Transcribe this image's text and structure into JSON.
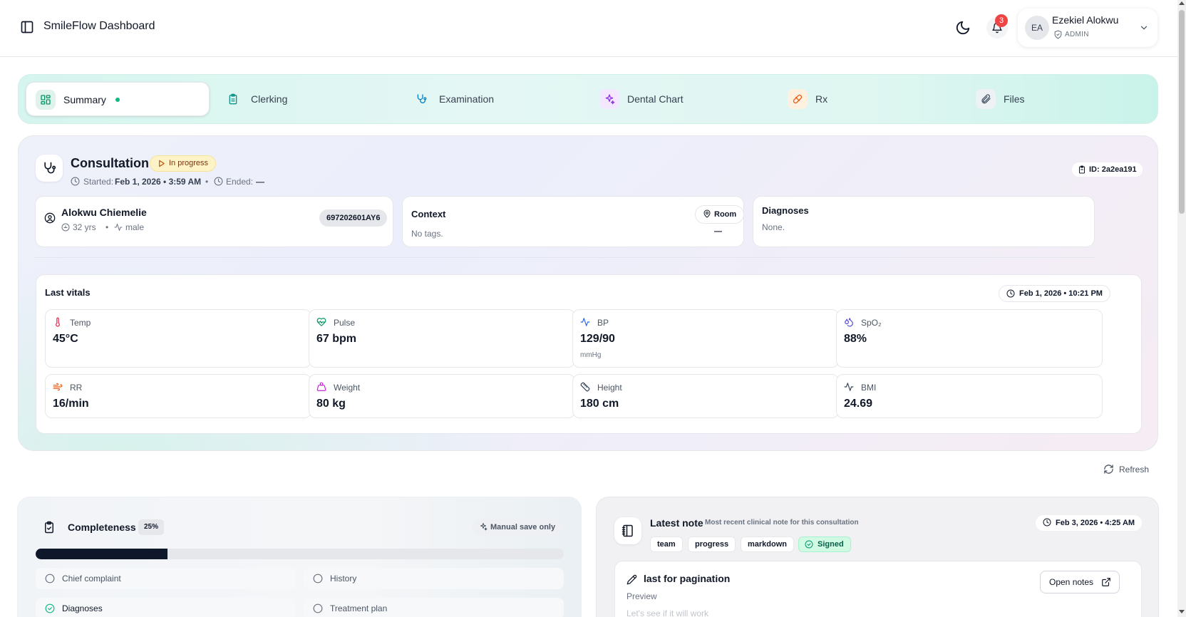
{
  "header": {
    "title": "SmileFlow Dashboard",
    "notifications_count": "3",
    "user": {
      "initials": "EA",
      "name": "Ezekiel Alokwu",
      "role": "ADMIN"
    }
  },
  "tabs": [
    {
      "label": "Summary",
      "icon": "grid-icon",
      "active": true
    },
    {
      "label": "Clerking",
      "icon": "clipboard-icon"
    },
    {
      "label": "Examination",
      "icon": "stethoscope-icon"
    },
    {
      "label": "Dental Chart",
      "icon": "sparkles-icon"
    },
    {
      "label": "Rx",
      "icon": "pill-icon"
    },
    {
      "label": "Files",
      "icon": "paperclip-icon"
    }
  ],
  "consultation": {
    "title": "Consultation",
    "status": "In progress",
    "started_label": "Started:",
    "started_value": "Feb 1, 2026 • 3:59 AM",
    "separator": "•",
    "ended_label": "Ended:",
    "ended_value": "—",
    "id_label": "ID: 2a2ea191"
  },
  "patient": {
    "name": "Alokwu Chiemelie",
    "age": "32 yrs",
    "separator": "•",
    "sex": "male",
    "mrn": "697202601AY6"
  },
  "context": {
    "title": "Context",
    "room": "Room —",
    "tags_text": "No tags."
  },
  "diagnoses": {
    "title": "Diagnoses",
    "text": "None."
  },
  "vitals": {
    "title": "Last vitals",
    "timestamp": "Feb 1, 2026 • 10:21 PM",
    "items": [
      {
        "label": "Temp",
        "value": "45°C",
        "icon": "thermometer-icon",
        "color": "#e11d48"
      },
      {
        "label": "Pulse",
        "value": "67 bpm",
        "icon": "heart-pulse-icon",
        "color": "#059669"
      },
      {
        "label": "BP",
        "value": "129/90",
        "unit": "mmHg",
        "icon": "activity-icon",
        "color": "#2563eb"
      },
      {
        "label": "SpO₂",
        "value": "88%",
        "icon": "droplets-icon",
        "color": "#4f46e5"
      },
      {
        "label": "RR",
        "value": "16/min",
        "icon": "wind-icon",
        "color": "#ea580c"
      },
      {
        "label": "Weight",
        "value": "80 kg",
        "icon": "weight-icon",
        "color": "#c026d3"
      },
      {
        "label": "Height",
        "value": "180 cm",
        "icon": "ruler-icon",
        "color": "#334155"
      },
      {
        "label": "BMI",
        "value": "24.69",
        "icon": "activity-icon",
        "color": "#334155"
      }
    ]
  },
  "refresh_label": "Refresh",
  "completeness": {
    "title": "Completeness",
    "percent_label": "25%",
    "progress_fraction": 0.25,
    "manual_label": "Manual save only",
    "items": [
      {
        "label": "Chief complaint",
        "done": false
      },
      {
        "label": "History",
        "done": false
      },
      {
        "label": "Diagnoses",
        "done": true
      },
      {
        "label": "Treatment plan",
        "done": false
      }
    ]
  },
  "latest_note": {
    "title": "Latest note",
    "subtitle": "Most recent clinical note for this consultation",
    "date": "Feb 3, 2026 • 4:25 AM",
    "tags": [
      "team",
      "progress",
      "markdown"
    ],
    "signed_label": "Signed",
    "note_title": "last for pagination",
    "preview_label": "Preview",
    "body": "Let's see if it will work",
    "open_label": "Open notes"
  },
  "colors": {
    "accent": "#10b981",
    "badge": "#ef4444",
    "progress": "#0f172a"
  }
}
